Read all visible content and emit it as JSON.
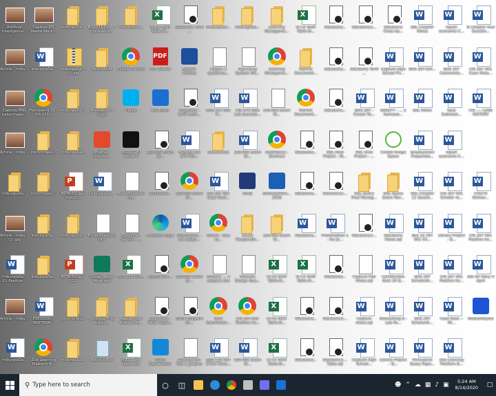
{
  "desktop": {
    "icons": [
      [
        "Artificial Intelligence...",
        "Capture.JPG Media Work...",
        "ImburgiaSa...",
        "BUS271 Co... 2 homework...",
        "ImburgiaSa...",
        "H.T.S Tariff Table-bi...",
        "SQLQuery Tariff ...",
        "ImburgiaSa...",
        "ImburgiaSa...",
        "Learning Manageme...",
        "H.T.S Tariff Table-bi...",
        "SQLQuery...",
        "SQLQuery1...",
        "SQLQuery Cross ba...",
        "BSL Chapter Notes",
        "report economic-C...",
        "IS Chapter Four Questio..."
      ],
      [
        "Article - Imbu...",
        "ImburgiaSa...",
        "ImburgiaSa... (2).zip",
        "HelloWorld",
        "Google Chrome",
        "PDF Reader",
        "Brother Utilities",
        "Kaplan 3 questions...",
        "Operating System Wo...",
        "Learning Manageme...",
        "MyFirst Document...",
        "SQLQuery...",
        "SQLQuery Tariff ...",
        "Capture High School Pri...",
        "BUS 297-Ent...",
        "BUS 297 Comments...",
        "CIS 267 001 Case Histo..."
      ],
      [
        "Capture.PNG baby.image...",
        "Homework 11 - CIS 271...",
        "ImburgiaSa...",
        "HelloWorld - Copy",
        "Skype",
        "Kali Linux",
        "SQLQuery - tariff code...",
        "BUS 271 001 P...",
        "CIS 274 NDA Lab exercise...",
        "220-902 Exam Si...",
        "MyFirst Document...",
        "SQLQuery...",
        "BUS 297 - Career Pa...",
        "BUS277 - ... 2 homewo...",
        "BSL Notes",
        "Quiz Submissi...",
        "CIS ---- CASE HISTORY"
      ],
      [
        "Article - Imbu...",
        "mictchmess...",
        "ImburgiaSa...",
        "Brother Creative...",
        "ASUS GPU Tweak II",
        "220-902 Exam Si...",
        "Hadoop CIS 274 MKr...",
        "Documents",
        "220-902 Exam Si...",
        "wireless(1) - Shortcut",
        "SQLQuery...",
        "SQL Final Project - St...",
        "SQL Final Project - ...",
        "Create Image Space",
        "Employment Preparatio...",
        "report economic-C..."
      ],
      [
        "ImburgiaSa...",
        "mictchmess...",
        "BSTA 5 Copy GGGG...",
        "ImburgiaSa...",
        "Blank Diagram (H...",
        "SQLQuery...",
        "220-902 Exam Si...",
        "CIS 267 001 Case Stud...",
        "BlueJ",
        "BusinessPara... 2018",
        "SQLQuery...",
        "SQLQuery1...",
        "SQL Query Final Manag...",
        "SQL Query Exam Rev...",
        "SQL Chapter 11 Questi...",
        "CIS 267 001 Scholar ra...",
        "CIS274 Networ..."
      ],
      [
        "Article - Imbu... (1).jpg",
        "ImburgiaSa...",
        "ImburgiaSa...",
        "Elliott Diagram (H...",
        "Customer Service - ...",
        "Microsoft Edge",
        "ImburgiaSa... 1st assign...",
        "Oracle - Q12 cs...",
        "Social Responsibi...",
        "220-902 Exam Si...",
        "SQLQuery...",
        "Presentation 1 - for Ja...",
        "SQLQuery1...",
        "SQLQuery Views.sql",
        "Bus 15 297 001 Ch...",
        "Library Project - Q...",
        "CIS 267 001 Positive Ira...",
        "CIS274 Networ..."
      ],
      [
        "ImburgiaSa... 11 Positive...",
        "ImburgiaSa...",
        "BSTA 5 Copy GGG",
        "Chase Webex Meetings",
        "BUS 297 004...",
        "SQLQuery1...",
        "220-902 Exam Si...",
        "BUS271 ... 4 copy(1).xlsx",
        "Network Design Qua...",
        "H.T.S Tariff Table-bi...",
        "H.T.S Tariff Table-bi...",
        "SQLQuery...",
        "Capture Pub Views.sql",
        "Certification Quiz 10 Q...",
        "BUS 297 Scholarsh...",
        "CIS 267 001 Positive Ira...",
        "Ask for Mary 9 April"
      ],
      [
        "Article - Imbu...",
        "PSEUDOC... MIDTERM...",
        "Intro to Java",
        "Pet Shop Final Busin...",
        "Pseudocode Midterm E...",
        "SQLQuery - Table reque...",
        "Blank Diagram (H...",
        "Quiz Submission...",
        "CIS 267-001 Positive Ira...",
        "H.T.S Tariff Table-bi...",
        "SQLQuery...",
        "SQLQuery1...",
        "Capture views.sql",
        "Networking 8 - Lab Fo...",
        "BUS 297 Scholarsh...",
        "Case Rese -- Mi...",
        "Malwarebytes"
      ],
      [
        "ImburgiaSa...",
        "Zoe Learning Platform B...",
        "ImburgiaSa...",
        "Recycle Bin",
        "H.T.S Tariff Table.xlsx",
        "XSplit Gamecaster",
        "Certification Test 1 (Kaplan 3)",
        "BUS 115 007 CT#4 Trans...",
        "220-902 Exam Si...",
        "H.T.S Tariff Table-bi...",
        "SQLQuery...",
        "SQLQuery1... Table.sql",
        "Capture High School...",
        "Library Project - Q...",
        "Persuasive Essay Repo...",
        "Zoe Learning Platform B..."
      ]
    ],
    "types": [
      [
        "image",
        "image",
        "folder",
        "folder",
        "folder",
        "excel",
        "sql",
        "folder",
        "folder",
        "folder",
        "excel",
        "sql",
        "sql",
        "sql",
        "word",
        "word",
        "word"
      ],
      [
        "image",
        "word",
        "zip",
        "folder",
        "chrome",
        "pdf",
        "app-brother",
        "doc",
        "doc",
        "chrome",
        "folder",
        "sql",
        "sql",
        "word",
        "word",
        "word",
        "word"
      ],
      [
        "image",
        "chrome",
        "folder",
        "folder",
        "app-skype",
        "app-kali",
        "sql",
        "word",
        "word",
        "doc",
        "chrome",
        "sql",
        "word",
        "word",
        "word",
        "word",
        "word"
      ],
      [
        "image",
        "folder",
        "folder",
        "app-creative",
        "app-asus",
        "sql",
        "word",
        "folder",
        "word",
        "chrome",
        "sql",
        "sql",
        "sql",
        "app-green",
        "word",
        "word"
      ],
      [
        "folder",
        "folder",
        "ppt",
        "word",
        "doc",
        "sql",
        "chrome",
        "word",
        "app-bluej",
        "app-biz",
        "sql",
        "sql",
        "folder",
        "folder",
        "word",
        "word",
        "word"
      ],
      [
        "image",
        "folder",
        "folder",
        "doc",
        "doc",
        "edge",
        "word",
        "chrome",
        "folder",
        "folder",
        "word",
        "word",
        "sql",
        "word",
        "word",
        "word",
        "word",
        "word"
      ],
      [
        "word",
        "folder",
        "ppt",
        "app-webex",
        "excel",
        "sql",
        "chrome",
        "doc",
        "doc",
        "excel",
        "excel",
        "sql",
        "doc",
        "word",
        "word",
        "word",
        "word"
      ],
      [
        "image",
        "word",
        "folder",
        "folder",
        "folder",
        "sql",
        "sql",
        "chrome",
        "chrome",
        "excel",
        "sql",
        "sql",
        "word",
        "word",
        "word",
        "word",
        "app-malware"
      ],
      [
        "word",
        "chrome",
        "folder",
        "recycle",
        "excel",
        "app-xsplit",
        "doc",
        "word",
        "word",
        "excel",
        "sql",
        "sql",
        "word",
        "word",
        "word",
        "word"
      ]
    ]
  },
  "taskbar": {
    "search_placeholder": "Type here to search",
    "time": "5:24 AM",
    "date": "8/14/2020",
    "apps": [
      {
        "name": "cortana",
        "color": "#ffffff"
      },
      {
        "name": "task-view",
        "color": "#ffffff"
      },
      {
        "name": "file-explorer",
        "color": "#f4c34e"
      },
      {
        "name": "edge",
        "color": "#2f8ad8"
      },
      {
        "name": "chrome",
        "color": "#d94b3b"
      },
      {
        "name": "sql-server",
        "color": "#bfbfbf"
      },
      {
        "name": "store",
        "color": "#6f6ff0"
      },
      {
        "name": "mail",
        "color": "#1c6fd4"
      }
    ]
  }
}
